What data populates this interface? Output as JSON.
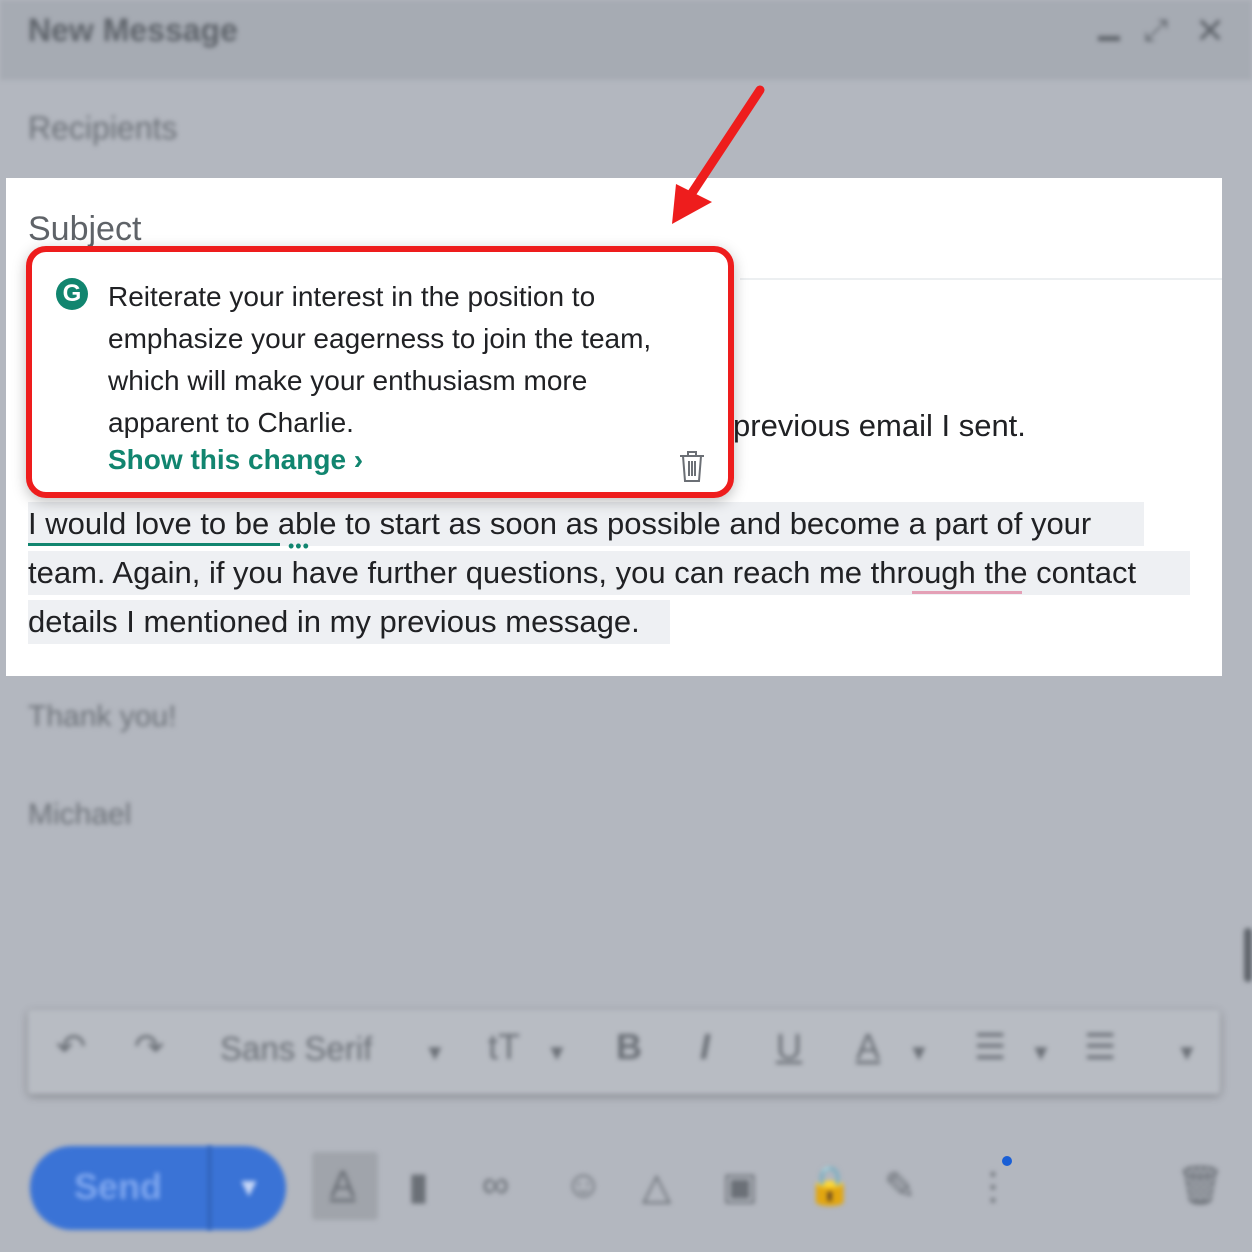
{
  "window": {
    "title": "New Message",
    "controls": {
      "minimize_icon": "minimize-icon",
      "expand_icon": "expand-icon",
      "close_icon": "close-icon"
    }
  },
  "compose": {
    "recipients_placeholder": "Recipients",
    "subject_placeholder": "Subject",
    "partial_line": "previous email I sent.",
    "body_lines": [
      "I would love to be able to start as soon as possible and become a part of your",
      "team. Again, if you have further questions, you can reach me through the contact",
      "details I mentioned in my previous message."
    ],
    "closing": "Thank you!",
    "signature": "Michael"
  },
  "suggestion_card": {
    "logo_letter": "G",
    "text": "Reiterate your interest in the position to emphasize your eagerness to join the team, which will make your enthusiasm more apparent to Charlie.",
    "link": "Show this change ›",
    "dismiss_icon": "trash-icon",
    "accent_color": "#11856f",
    "highlight_border_color": "#ee1d1d"
  },
  "toolbar": {
    "font": "Sans Serif",
    "bold": "B",
    "italic": "I",
    "underline": "U",
    "text_color": "A",
    "font_size_glyph": "tT"
  },
  "footer": {
    "send_label": "Send",
    "format_glyph": "A"
  },
  "colors": {
    "overlay": "#b3b7bf",
    "send_button": "#3a73d6",
    "annotation_arrow": "#ee1d1d"
  }
}
